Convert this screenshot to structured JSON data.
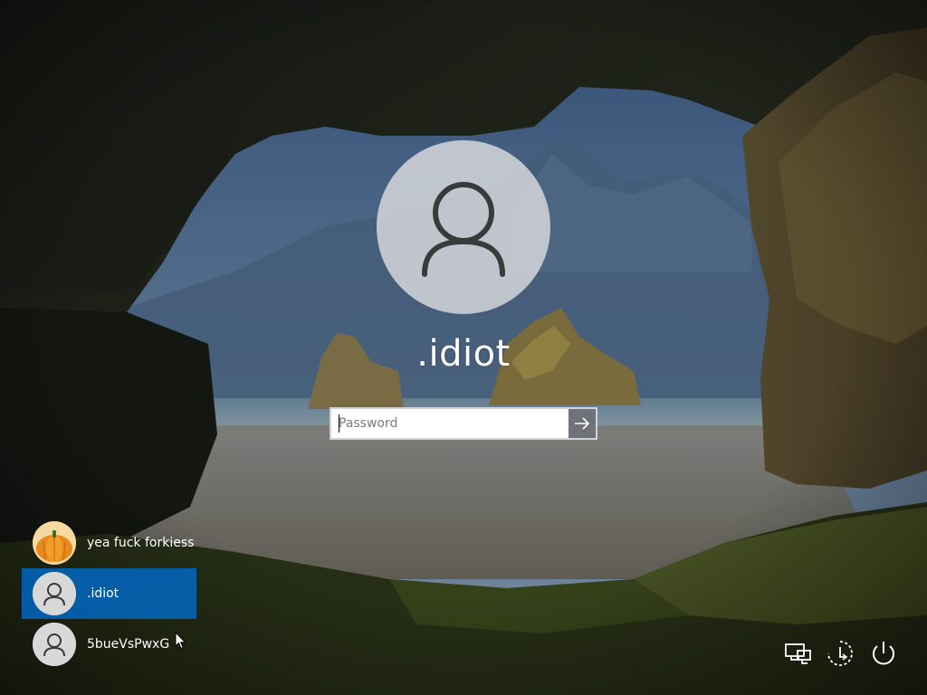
{
  "lock_screen": {
    "current_user": {
      "name": ".idiot",
      "avatar_icon": "user-silhouette-icon"
    },
    "password": {
      "placeholder": "Password",
      "value": "",
      "submit_icon": "arrow-right-icon"
    }
  },
  "user_list": {
    "items": [
      {
        "label": "yea fuck forkiess",
        "avatar_icon": "pumpkin-avatar",
        "selected": false
      },
      {
        "label": ".idiot",
        "avatar_icon": "user-silhouette-icon",
        "selected": true
      },
      {
        "label": "5bueVsPwxG",
        "avatar_icon": "user-silhouette-icon",
        "selected": false
      }
    ]
  },
  "system_tray": {
    "items": [
      {
        "name": "network-icon"
      },
      {
        "name": "ease-of-access-icon"
      },
      {
        "name": "power-icon"
      }
    ]
  },
  "colors": {
    "selected_item": "#0067c0",
    "submit_button": "#6f7379",
    "avatar_bg": "#d4d6d8",
    "text": "#ffffff"
  }
}
